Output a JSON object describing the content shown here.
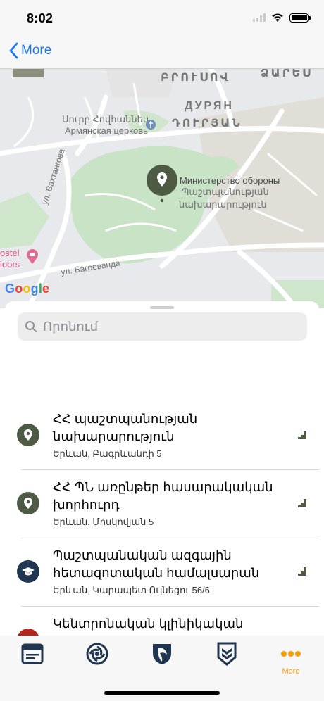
{
  "status_bar": {
    "time": "8:02"
  },
  "nav": {
    "back_label": "More"
  },
  "map": {
    "labels": {
      "district_armenian_top": "ԲՐՈՒՍՈՎ",
      "district_armenian_right": "ՁԱՐԵՍ",
      "district_russian": "ДУРЯН",
      "district_armenian": "ԴՈՒՐՅԱՆ",
      "church_armenian": "Սուրբ Հովհաննես",
      "church_russian": "Армянская церковь",
      "ministry_russian": "Министерство обороны",
      "ministry_armenian_1": "Պաշտպանության",
      "ministry_armenian_2": "նախարարություն",
      "street_vakhtangov": "ул. Вахтангова",
      "street_bagrevand": "ул. Багреванда",
      "hostel_1": "ostel",
      "hostel_2": "loors",
      "google": "Google"
    }
  },
  "search": {
    "placeholder": "Որոնում"
  },
  "list": [
    {
      "title": "ՀՀ պաշտպանության նախարարություն",
      "address": "Երևան, Բագրևանդի 5",
      "icon": "location-pin-icon",
      "icon_color": "#4d5a44"
    },
    {
      "title": "ՀՀ ՊՆ առընթեր հասարակական խորհուրդ",
      "address": "Երևան, Մոսկովյան 5",
      "icon": "location-pin-icon",
      "icon_color": "#4d5a44"
    },
    {
      "title": "Պաշտպանական ազգային հետազոտական համալսարան",
      "address": "Երևան, Կարապետ Ուլնեցու 56/6",
      "icon": "graduation-cap-icon",
      "icon_color": "#1f3550"
    },
    {
      "title": "Կենտրոնական կլինիկական",
      "address": "",
      "icon": "medical-icon",
      "icon_color": "#b3261e"
    }
  ],
  "tabs": [
    {
      "name": "news",
      "icon": "browser-window-icon"
    },
    {
      "name": "emblem",
      "icon": "eternity-emblem-icon"
    },
    {
      "name": "shield",
      "icon": "shield-emblem-icon"
    },
    {
      "name": "rank",
      "icon": "rank-chevron-icon"
    },
    {
      "name": "more",
      "icon": "more-dots-icon",
      "label": "More"
    }
  ],
  "colors": {
    "accent": "#1877f2",
    "tab_icon": "#1f3550",
    "tab_active": "#f59e0b",
    "pin": "#4d5a44"
  }
}
